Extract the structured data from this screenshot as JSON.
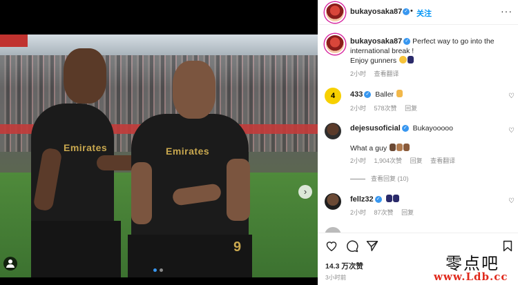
{
  "post": {
    "username": "bukayosaka87",
    "separator": "•",
    "follow_label": "关注",
    "more_label": "···",
    "photo": {
      "sponsor_text": "Emirates",
      "shirt_number": "9",
      "next_arrow": "›"
    },
    "caption": {
      "username": "bukayosaka87",
      "text_line1": "Perfect way to go into the",
      "text_line2": "international break !",
      "text_line3": "Enjoy gunners",
      "time": "2小时",
      "translate_label": "查看翻译"
    },
    "comments": [
      {
        "username": "433",
        "avatar_label": "4",
        "text": "Baller",
        "time": "2小时",
        "likes": "578次赞",
        "reply_label": "回复"
      },
      {
        "username": "dejesusoficial",
        "text": "Bukayooooo",
        "reply_text": "What a guy",
        "time": "2小时",
        "likes": "1,904次赞",
        "reply_label": "回复",
        "translate_label": "查看翻译",
        "view_replies": "查看回复 (10)"
      },
      {
        "username": "fellz32",
        "text": "",
        "time": "2小时",
        "likes": "87次赞",
        "reply_label": "回复"
      }
    ],
    "likes_count": "14.3 万次赞",
    "posted_time": "3小时前"
  },
  "watermark": {
    "line1": "零点吧",
    "line2": "www.Ldb.cc"
  },
  "colors": {
    "accent_blue": "#0095f6",
    "verified_blue": "#3897f0",
    "meta_gray": "#8e8e8e",
    "watermark_red": "#e0291c"
  },
  "icons": {
    "like": "heart-icon",
    "comment": "comment-icon",
    "share": "share-icon",
    "save": "bookmark-icon",
    "tag": "user-tag-icon",
    "verified": "verified-badge-icon"
  }
}
